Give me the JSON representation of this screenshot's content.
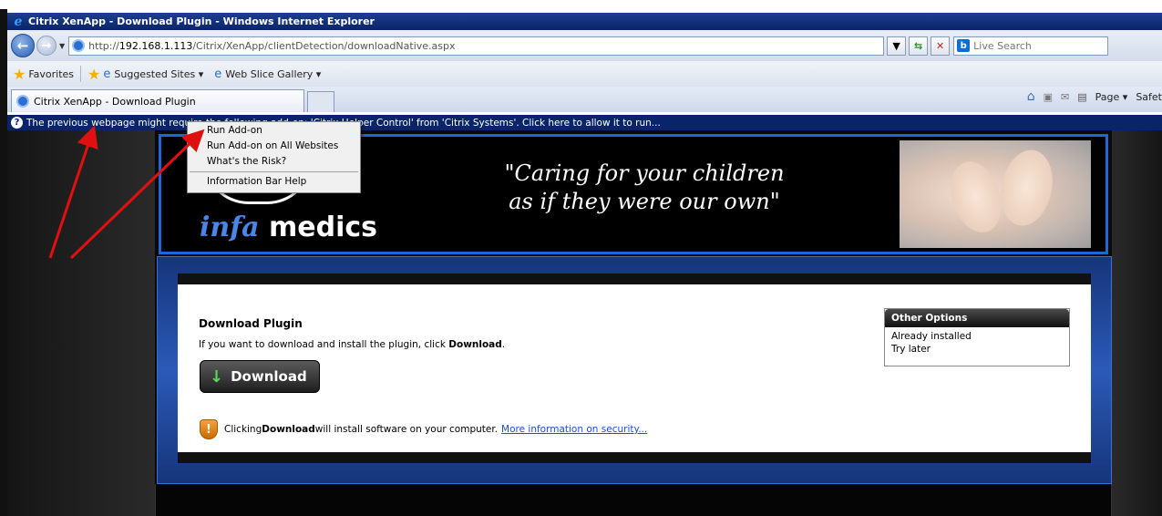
{
  "window": {
    "title": "Citrix XenApp - Download Plugin - Windows Internet Explorer"
  },
  "address": {
    "protocol": "http://",
    "host": "192.168.1.113",
    "path": "/Citrix/XenApp/clientDetection/downloadNative.aspx",
    "search_placeholder": "Live Search"
  },
  "favorites": {
    "label": "Favorites",
    "items": [
      "Suggested Sites ▾",
      "Web Slice Gallery ▾"
    ]
  },
  "tab": {
    "label": "Citrix XenApp - Download Plugin"
  },
  "commandbar": {
    "page": "Page ▾",
    "safety": "Safet"
  },
  "infobar": {
    "text": "The previous webpage might require the following add-on: 'Citrix Helper Control' from 'Citrix Systems'. Click here to allow it to run..."
  },
  "context_menu": {
    "items": [
      "Run Add-on",
      "Run Add-on on All Websites",
      "What's the Risk?"
    ],
    "help": "Information Bar Help"
  },
  "banner": {
    "logo_italic": "infa",
    "logo_bold": " medics",
    "slogan_line1": "\"Caring for your children",
    "slogan_line2": "as if they were our own\""
  },
  "download": {
    "heading": "Download Plugin",
    "instructions_prefix": "If you want to download and install the plugin, click ",
    "instructions_bold": "Download",
    "instructions_suffix": ".",
    "button_label": "Download",
    "security_prefix": "Clicking ",
    "security_bold": "Download",
    "security_suffix": " will install software on your computer.",
    "security_link": "More information on security..."
  },
  "other_options": {
    "title": "Other Options",
    "items": [
      "Already installed",
      "Try later"
    ]
  },
  "colors": {
    "infobar": "#0a246a",
    "accent_blue": "#1f66d6",
    "annotation_arrow": "#e11010"
  }
}
